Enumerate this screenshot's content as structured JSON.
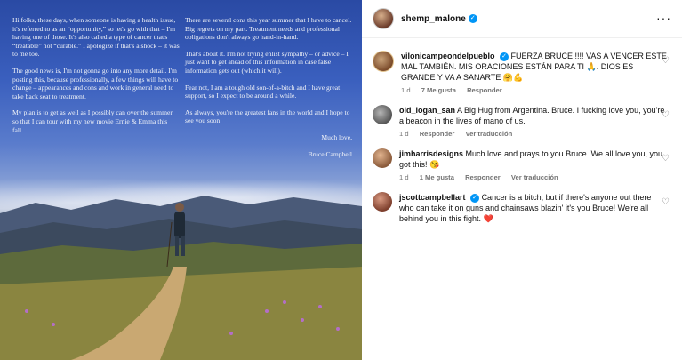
{
  "photo": {
    "col1": [
      "Hi folks, these days, when someone is having a health issue, it's referred to as an “opportunity,” so let's go with that – I'm having one of those. It's also called a type of cancer that's “treatable” not “curable.” I apologize if that's a shock – it was to me too.",
      "The good news is, I'm not gonna go into any more detail. I'm posting this, because professionally, a few things will have to change – appearances and cons and work in general need to take back seat to treatment.",
      "My plan is to get as well as I possibly can over the summer so that I can tour with my new movie Ernie & Emma this fall."
    ],
    "col2": [
      "There are several cons this year summer that I have to cancel. Big regrets on my part. Treatment needs and professional obligations don't always go hand-in-hand.",
      "That's about it. I'm not trying enlist sympathy – or advice – I just want to get ahead of this information in case false information gets out (which it will).",
      "Fear not, I am a tough old son-of-a-bitch and I have great support, so I expect to be around a while.",
      "As always, you're the greatest fans in the world and I hope to see you soon!"
    ],
    "closing": "Much love,",
    "signature": "Bruce Campbell"
  },
  "header": {
    "username": "shemp_malone",
    "more": "···"
  },
  "comments": [
    {
      "user": "vilonicampeondelpueblo",
      "verified": true,
      "text": "FUERZA BRUCE !!!! VAS A VENCER ESTE MAL TAMBIÉN. MIS ORACIONES ESTÁN PARA TI 🙏. DIOS ES GRANDE Y VA A SANARTE 🤗💪",
      "time": "1 d",
      "likes": "7 Me gusta",
      "reply": "Responder"
    },
    {
      "user": "old_logan_san",
      "verified": false,
      "text": "A Big Hug from Argentina. Bruce. I fucking love you, you're a beacon in the lives of mano of us.",
      "time": "1 d",
      "likes": "",
      "reply": "Responder",
      "translation": "Ver traducción"
    },
    {
      "user": "jimharrisdesigns",
      "verified": false,
      "text": "Much love and prays to you Bruce. We all love you, you got this! 😘",
      "time": "1 d",
      "likes": "1 Me gusta",
      "reply": "Responder",
      "translation": "Ver traducción"
    },
    {
      "user": "jscottcampbellart",
      "verified": true,
      "text": "Cancer is a bitch, but if there's anyone out there who can take it on guns and chainsaws blazin' it's you Bruce! We're all behind you in this fight. ❤️",
      "time": "",
      "likes": "",
      "reply": ""
    }
  ],
  "icons": {
    "heart": "heart-icon",
    "verified": "verified-icon"
  }
}
